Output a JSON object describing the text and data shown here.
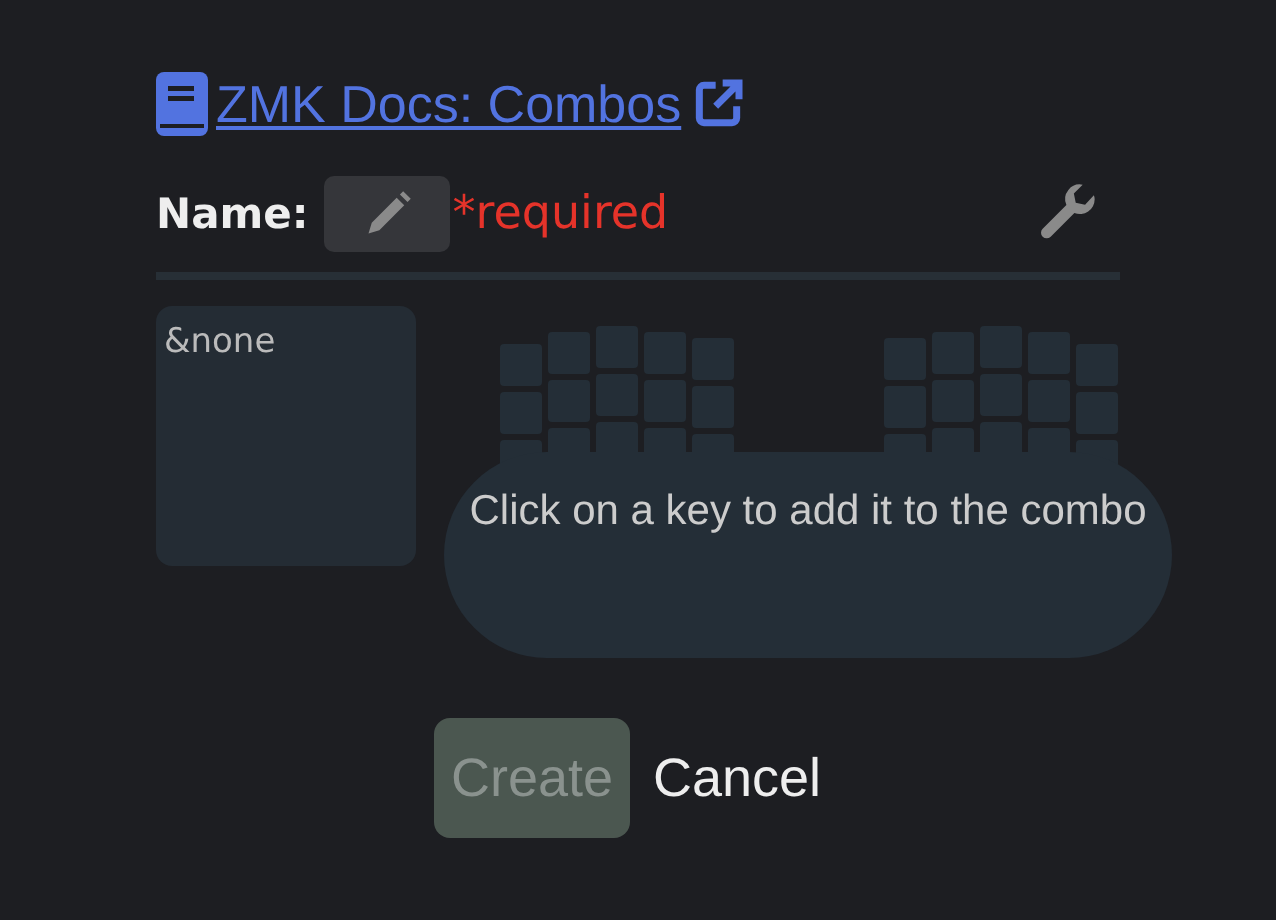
{
  "doc_link": {
    "text": "ZMK Docs: Combos"
  },
  "name_field": {
    "label": "Name:",
    "required_note": "*required"
  },
  "binding": {
    "text": "&none"
  },
  "hint": {
    "text": "Click on a key to add it to the combo"
  },
  "buttons": [
    {
      "label": "Create",
      "disabled": true
    },
    {
      "label": "Cancel",
      "disabled": false
    }
  ]
}
